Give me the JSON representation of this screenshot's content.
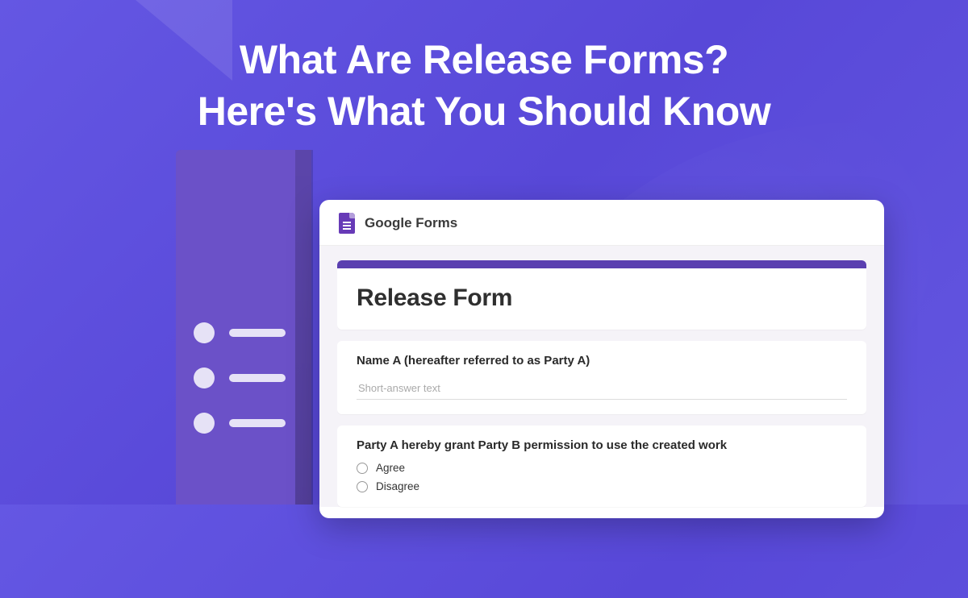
{
  "headline": {
    "line1": "What Are Release Forms?",
    "line2": "Here's What You Should Know"
  },
  "window": {
    "title": "Google Forms"
  },
  "form": {
    "title": "Release Form",
    "q1": {
      "label": "Name A (hereafter referred to as Party A)",
      "placeholder": "Short-answer text"
    },
    "q2": {
      "label": "Party A hereby grant Party B permission to use the created work",
      "opt1": "Agree",
      "opt2": "Disagree"
    }
  },
  "colors": {
    "accent": "#5a3fb0",
    "bg": "#5b4bdc"
  }
}
